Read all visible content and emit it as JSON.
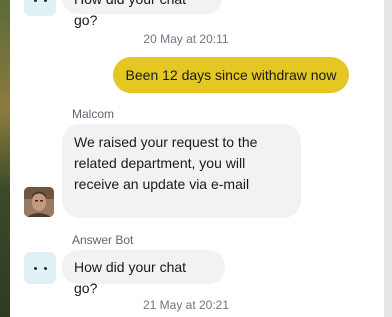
{
  "messages": {
    "top_bot_text": "How did your chat go?",
    "timestamp_1": "20 May at 20:11",
    "user_text": "Been 12 days since withdraw now",
    "agent_name": "Malcom",
    "agent_text": "We raised your request to the related department, you will receive an update via e-mail",
    "bot_name": "Answer Bot",
    "bot_text": "How did your chat go?",
    "timestamp_2": "21 May at 20:21"
  },
  "colors": {
    "user_bubble": "#e4c722",
    "incoming_bubble": "#f1f2f4",
    "bot_avatar_bg": "#dff1f6"
  },
  "icons": {
    "bot_avatar": "bot-dots-icon",
    "agent_avatar": "agent-photo"
  }
}
